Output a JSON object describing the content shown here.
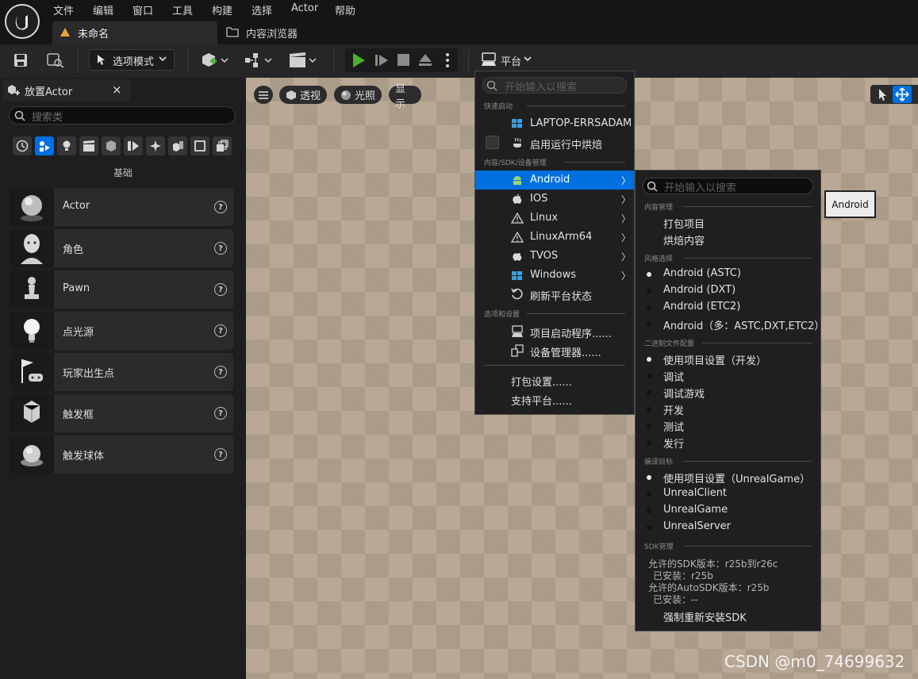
{
  "menubar": {
    "items": [
      "文件",
      "编辑",
      "窗口",
      "工具",
      "构建",
      "选择",
      "Actor",
      "帮助"
    ],
    "doc_tab": "未命名",
    "content_tab": "内容浏览器"
  },
  "toolbar": {
    "mode_label": "选项模式",
    "platform_label": "平台"
  },
  "left_panel": {
    "tab_label": "放置Actor",
    "close_glyph": "×",
    "search_placeholder": "搜索类",
    "category_label": "基础",
    "help_glyph": "?",
    "items": [
      "Actor",
      "角色",
      "Pawn",
      "点光源",
      "玩家出生点",
      "触发框",
      "触发球体"
    ]
  },
  "viewport": {
    "perspective": "透视",
    "lit": "光照",
    "show": "显示"
  },
  "platform_menu": {
    "search_placeholder": "开始输入以搜索",
    "quick_launch_header": "快速启动",
    "device_name": "LAPTOP-ERRSADAM",
    "cook_on_run": "启用运行中烘焙",
    "sdk_header": "内容/SDK/设备管理",
    "platforms": [
      "Android",
      "IOS",
      "Linux",
      "LinuxArm64",
      "TVOS",
      "Windows"
    ],
    "arrow_glyph": "〉",
    "refresh": "刷新平台状态",
    "options_header": "选项和设置",
    "project_launcher": "项目启动程序......",
    "device_manager": "设备管理器......",
    "packaging_settings": "打包设置......",
    "supported_platforms": "支持平台......"
  },
  "android_menu": {
    "search_placeholder": "开始输入以搜索",
    "content_header": "内容管理",
    "package_project": "打包项目",
    "cook_content": "烘焙内容",
    "flavor_header": "风格选择",
    "flavors": [
      "Android (ASTC)",
      "Android (DXT)",
      "Android (ETC2)",
      "Android（多：ASTC,DXT,ETC2）"
    ],
    "binary_header": "二进制文件配置",
    "binary_configs": [
      "使用项目设置（开发）",
      "调试",
      "调试游戏",
      "开发",
      "测试",
      "发行"
    ],
    "target_header": "编译目标",
    "targets": [
      "使用项目设置（UnrealGame）",
      "UnrealClient",
      "UnrealGame",
      "UnrealServer"
    ],
    "sdk_header": "SDK管理",
    "sdk_allowed": "允许的SDK版本：r25b到r26c",
    "sdk_installed": "已安装：r25b",
    "autosdk_allowed": "允许的AutoSDK版本：r25b",
    "autosdk_installed": "已安装：--",
    "force_reinstall": "强制重新安装SDK"
  },
  "tooltip": "Android",
  "watermark": "CSDN @m0_74699632",
  "colors": {
    "highlight": "#0070e0",
    "play_green": "#4caf32",
    "menu_bg": "#1f1f1f"
  }
}
